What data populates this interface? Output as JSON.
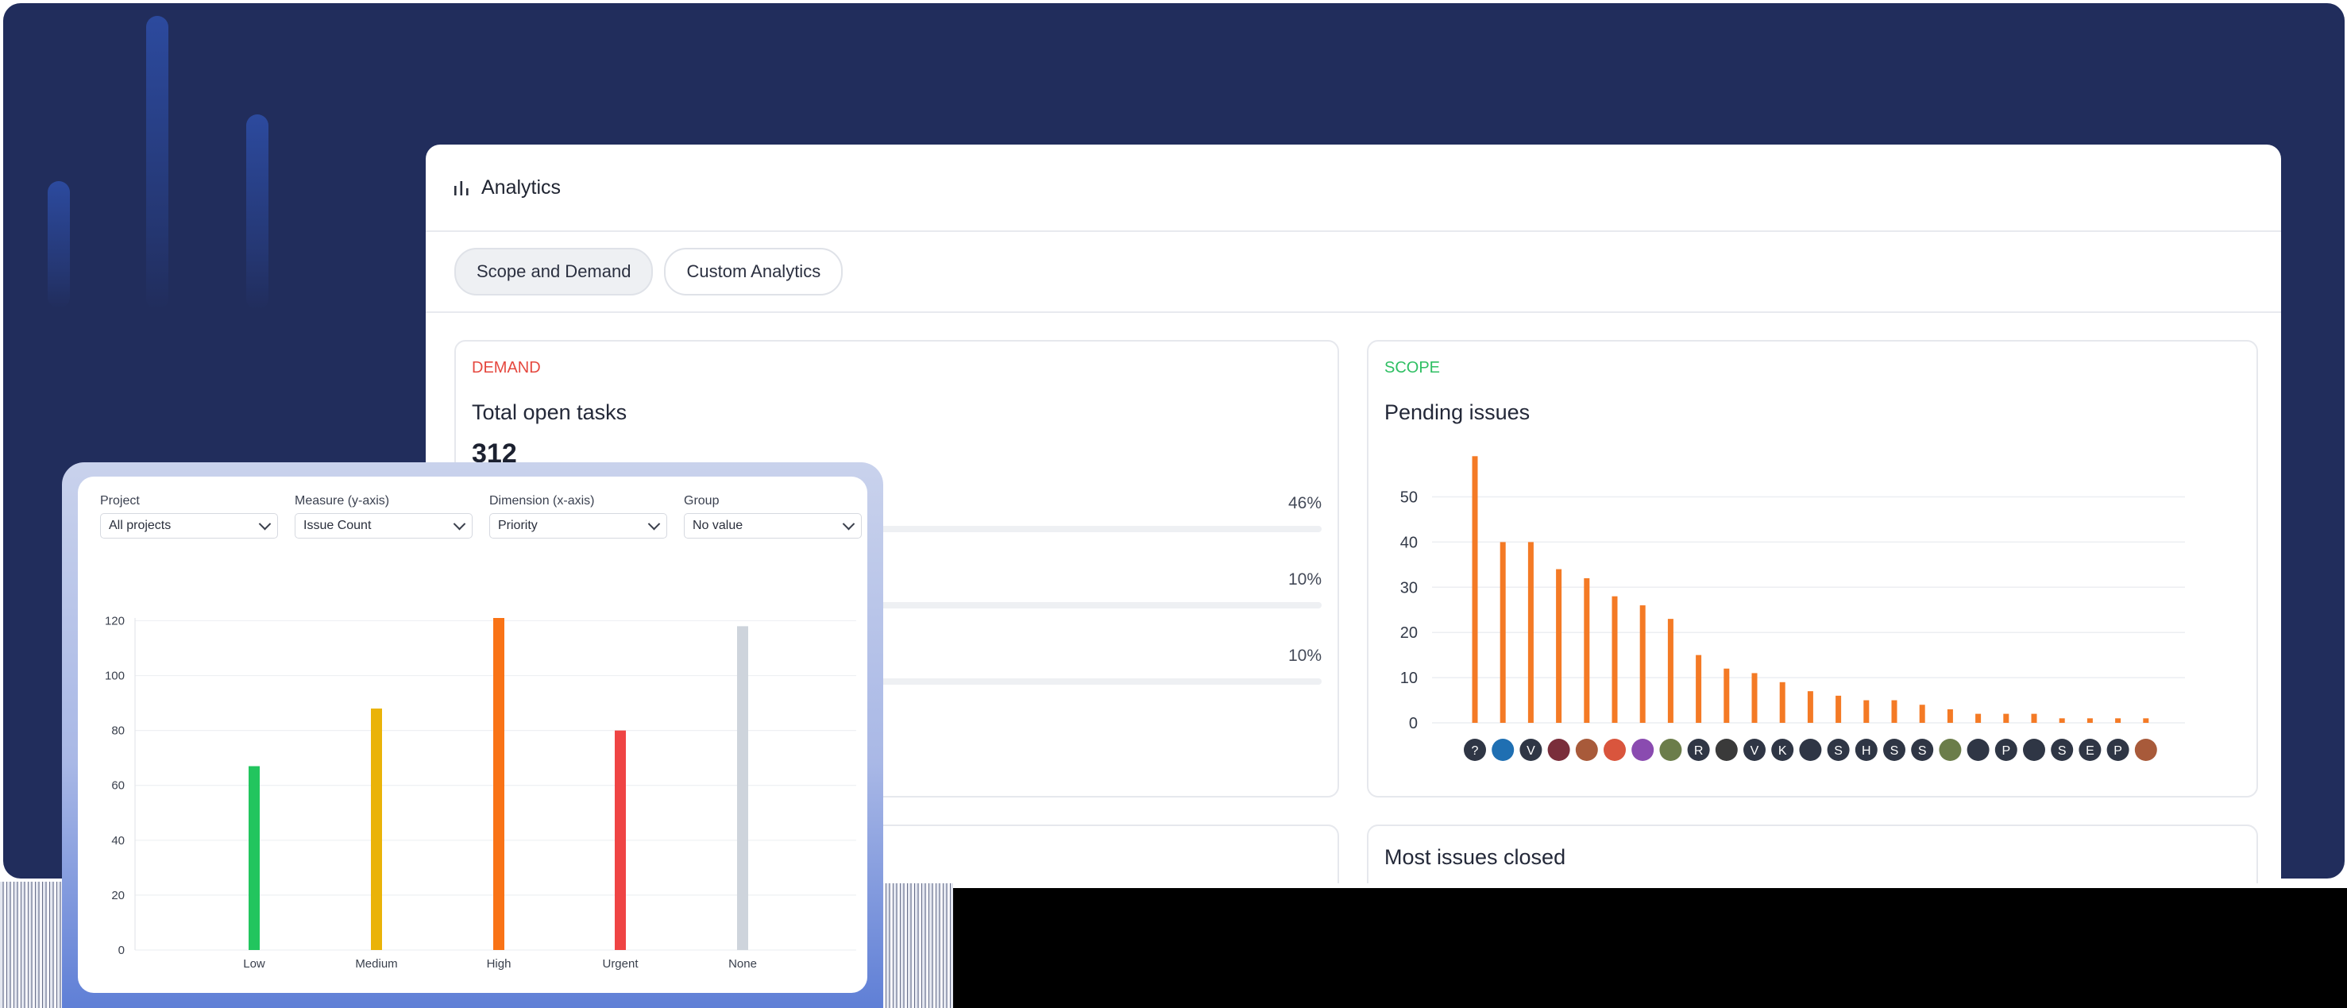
{
  "app": {
    "title": "Analytics",
    "icon": "bar-chart-icon"
  },
  "tabs": [
    {
      "label": "Scope and Demand",
      "active": true
    },
    {
      "label": "Custom Analytics",
      "active": false
    }
  ],
  "demand": {
    "eyebrow": "DEMAND",
    "eyebrow_color": "#e5483f",
    "title": "Total open tasks",
    "value": "312",
    "rows": [
      {
        "percent": "46%"
      },
      {
        "percent": "10%"
      },
      {
        "percent": "10%"
      }
    ]
  },
  "scope": {
    "eyebrow": "SCOPE",
    "eyebrow_color": "#2fbf63",
    "title": "Pending issues"
  },
  "most_closed": {
    "title": "Most issues closed"
  },
  "filters": [
    {
      "label": "Project",
      "value": "All projects"
    },
    {
      "label": "Measure (y-axis)",
      "value": "Issue Count"
    },
    {
      "label": "Dimension (x-axis)",
      "value": "Priority"
    },
    {
      "label": "Group",
      "value": "No value"
    }
  ],
  "chart_data": [
    {
      "type": "bar",
      "title": "Pending issues",
      "ylim": [
        0,
        58
      ],
      "yticks": [
        0,
        10,
        20,
        30,
        40,
        50
      ],
      "grid": true,
      "color": "#f47a25",
      "categories": [
        "?",
        "avatar",
        "V",
        "avatar",
        "avatar",
        "avatar",
        "avatar",
        "avatar",
        "R",
        "avatar",
        "V",
        "K",
        "avatar",
        "S",
        "H",
        "S",
        "S",
        "avatar",
        "avatar",
        "P",
        "avatar",
        "S",
        "E",
        "P",
        "avatar"
      ],
      "values": [
        59,
        40,
        40,
        34,
        32,
        28,
        26,
        23,
        15,
        12,
        11,
        9,
        7,
        6,
        5,
        5,
        4,
        3,
        2,
        2,
        2,
        1,
        1,
        1,
        1
      ]
    },
    {
      "type": "bar",
      "ylim": [
        0,
        120
      ],
      "yticks": [
        0,
        20,
        40,
        60,
        80,
        100,
        120
      ],
      "grid": true,
      "categories": [
        "Low",
        "Medium",
        "High",
        "Urgent",
        "None"
      ],
      "values": [
        67,
        88,
        121,
        80,
        118
      ],
      "colors": [
        "#22c55e",
        "#eab308",
        "#f97316",
        "#ef4444",
        "#ced4dc"
      ]
    }
  ]
}
